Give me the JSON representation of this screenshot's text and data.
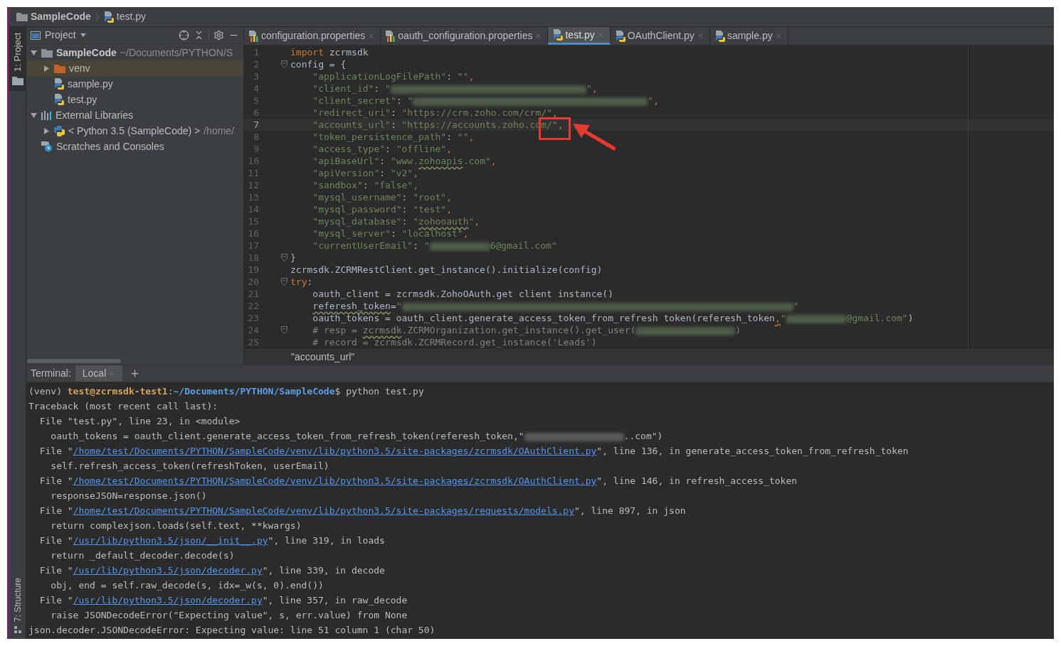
{
  "breadcrumb": [
    {
      "label": "SampleCode",
      "kind": "folder"
    },
    {
      "label": "test.py",
      "kind": "python"
    }
  ],
  "tool_strip": {
    "top": "1: Project",
    "bottom": "7: Structure"
  },
  "project_panel": {
    "title": "Project",
    "tree": [
      {
        "label": "SampleCode",
        "detail": "~/Documents/PYTHON/S",
        "kind": "project",
        "expanded": true,
        "selected": false,
        "children": [
          {
            "label": "venv",
            "kind": "excluded-folder",
            "expanded": false,
            "selected": true
          },
          {
            "label": "sample.py",
            "kind": "python",
            "selected": false
          },
          {
            "label": "test.py",
            "kind": "python",
            "selected": false
          }
        ]
      },
      {
        "label": "External Libraries",
        "kind": "libraries",
        "expanded": true,
        "selected": false,
        "children": [
          {
            "label": "< Python 3.5 (SampleCode) >",
            "detail": "/home/",
            "kind": "sdk",
            "expanded": false,
            "selected": false
          }
        ]
      },
      {
        "label": "Scratches and Consoles",
        "kind": "scratches",
        "selected": false
      }
    ]
  },
  "editor": {
    "tabs": [
      {
        "label": "configuration.properties",
        "kind": "properties",
        "selected": false
      },
      {
        "label": "oauth_configuration.properties",
        "kind": "properties",
        "selected": false
      },
      {
        "label": "test.py",
        "kind": "python",
        "selected": true
      },
      {
        "label": "OAuthClient.py",
        "kind": "python",
        "selected": false
      },
      {
        "label": "sample.py",
        "kind": "python",
        "selected": false
      }
    ],
    "lines": [
      {
        "number": "1",
        "current": false,
        "fold": false,
        "segments": [
          {
            "kind": "kw",
            "text": "import"
          },
          {
            "kind": "id",
            "text": " zcrmsdk"
          }
        ]
      },
      {
        "number": "2",
        "current": false,
        "fold": true,
        "segments": [
          {
            "kind": "id",
            "text": "config = {"
          }
        ]
      },
      {
        "number": "3",
        "current": false,
        "fold": false,
        "segments": [
          {
            "kind": "str",
            "text": "    \"applicationLogFilePath\""
          },
          {
            "kind": "id",
            "text": ": "
          },
          {
            "kind": "str",
            "text": "\"\""
          },
          {
            "kind": "punct",
            "text": ","
          }
        ]
      },
      {
        "number": "4",
        "current": false,
        "fold": false,
        "segments": [
          {
            "kind": "str",
            "text": "    \"client_id\""
          },
          {
            "kind": "id",
            "text": ": "
          },
          {
            "kind": "str",
            "text": "\""
          },
          {
            "kind": "redacted-l"
          },
          {
            "kind": "str",
            "text": "\""
          },
          {
            "kind": "punct",
            "text": ","
          }
        ]
      },
      {
        "number": "5",
        "current": false,
        "fold": false,
        "segments": [
          {
            "kind": "str",
            "text": "    \"client_secret\""
          },
          {
            "kind": "id",
            "text": ": "
          },
          {
            "kind": "str",
            "text": "\""
          },
          {
            "kind": "redacted-xl"
          },
          {
            "kind": "str",
            "text": "\""
          },
          {
            "kind": "punct",
            "text": ","
          }
        ]
      },
      {
        "number": "6",
        "current": false,
        "fold": false,
        "segments": [
          {
            "kind": "str",
            "text": "    \"redirect_uri\""
          },
          {
            "kind": "id",
            "text": ": "
          },
          {
            "kind": "str",
            "text": "\"https://crm.zoho.com/crm/\""
          },
          {
            "kind": "punct",
            "text": ","
          }
        ]
      },
      {
        "number": "7",
        "current": true,
        "fold": false,
        "segments": [
          {
            "kind": "str",
            "text": "    \"accounts_url\""
          },
          {
            "kind": "id",
            "text": ": "
          },
          {
            "kind": "str",
            "text": "\"https://accounts.zoho.com/\""
          },
          {
            "kind": "punct",
            "text": ","
          }
        ]
      },
      {
        "number": "8",
        "current": false,
        "fold": false,
        "segments": [
          {
            "kind": "str",
            "text": "    \"token_persistence_path\""
          },
          {
            "kind": "id",
            "text": ": "
          },
          {
            "kind": "str",
            "text": "\"\""
          },
          {
            "kind": "punct",
            "text": ","
          }
        ]
      },
      {
        "number": "9",
        "current": false,
        "fold": false,
        "segments": [
          {
            "kind": "str",
            "text": "    \"access_type\""
          },
          {
            "kind": "id",
            "text": ": "
          },
          {
            "kind": "str",
            "text": "\"offline\""
          },
          {
            "kind": "punct",
            "text": ","
          }
        ]
      },
      {
        "number": "10",
        "current": false,
        "fold": false,
        "segments": [
          {
            "kind": "str",
            "text": "    \"apiBaseUrl\""
          },
          {
            "kind": "id",
            "text": ": "
          },
          {
            "kind": "str",
            "text": "\"www."
          },
          {
            "kind": "str-typo",
            "text": "zohoapis"
          },
          {
            "kind": "str",
            "text": ".com\""
          },
          {
            "kind": "punct",
            "text": ","
          }
        ]
      },
      {
        "number": "11",
        "current": false,
        "fold": false,
        "segments": [
          {
            "kind": "str",
            "text": "    \"apiVersion\""
          },
          {
            "kind": "id",
            "text": ": "
          },
          {
            "kind": "str",
            "text": "\"v2\""
          },
          {
            "kind": "punct",
            "text": ","
          }
        ]
      },
      {
        "number": "12",
        "current": false,
        "fold": false,
        "segments": [
          {
            "kind": "str",
            "text": "    \"sandbox\""
          },
          {
            "kind": "id",
            "text": ": "
          },
          {
            "kind": "str",
            "text": "\"false\""
          },
          {
            "kind": "punct",
            "text": ","
          }
        ]
      },
      {
        "number": "13",
        "current": false,
        "fold": false,
        "segments": [
          {
            "kind": "str",
            "text": "    \"mysql_username\""
          },
          {
            "kind": "id",
            "text": ": "
          },
          {
            "kind": "str",
            "text": "\"root\""
          },
          {
            "kind": "punct",
            "text": ","
          }
        ]
      },
      {
        "number": "14",
        "current": false,
        "fold": false,
        "segments": [
          {
            "kind": "str",
            "text": "    \"mysql_password\""
          },
          {
            "kind": "id",
            "text": ": "
          },
          {
            "kind": "str",
            "text": "\"test\""
          },
          {
            "kind": "punct",
            "text": ","
          }
        ]
      },
      {
        "number": "15",
        "current": false,
        "fold": false,
        "segments": [
          {
            "kind": "str",
            "text": "    \"mysql_database\""
          },
          {
            "kind": "id",
            "text": ": "
          },
          {
            "kind": "str",
            "text": "\""
          },
          {
            "kind": "str-typo",
            "text": "zohooauth"
          },
          {
            "kind": "str",
            "text": "\""
          },
          {
            "kind": "punct",
            "text": ","
          }
        ]
      },
      {
        "number": "16",
        "current": false,
        "fold": false,
        "segments": [
          {
            "kind": "str",
            "text": "    \"mysql_server\""
          },
          {
            "kind": "id",
            "text": ": "
          },
          {
            "kind": "str",
            "text": "\"localhost\""
          },
          {
            "kind": "punct",
            "text": ","
          }
        ]
      },
      {
        "number": "17",
        "current": false,
        "fold": false,
        "segments": [
          {
            "kind": "str",
            "text": "    \"currentUserEmail\""
          },
          {
            "kind": "id",
            "text": ": "
          },
          {
            "kind": "str",
            "text": "\""
          },
          {
            "kind": "redacted-s"
          },
          {
            "kind": "str",
            "text": "6@gmail.com\""
          }
        ]
      },
      {
        "number": "18",
        "current": false,
        "fold": true,
        "segments": [
          {
            "kind": "id",
            "text": "}"
          }
        ]
      },
      {
        "number": "19",
        "current": false,
        "fold": false,
        "segments": [
          {
            "kind": "id",
            "text": "zcrmsdk.ZCRMRestClient.get_instance().initialize(config)"
          }
        ]
      },
      {
        "number": "20",
        "current": false,
        "fold": true,
        "segments": [
          {
            "kind": "kw",
            "text": "try"
          },
          {
            "kind": "id",
            "text": ":"
          }
        ]
      },
      {
        "number": "21",
        "current": false,
        "fold": false,
        "segments": [
          {
            "kind": "id",
            "text": "    oauth_client = zcrmsdk.ZohoOAuth.get client instance()"
          }
        ]
      },
      {
        "number": "22",
        "current": false,
        "fold": false,
        "segments": [
          {
            "kind": "typo",
            "text": "    referesh_token"
          },
          {
            "kind": "id",
            "text": "="
          },
          {
            "kind": "str",
            "text": "\""
          },
          {
            "kind": "redacted-xxl"
          },
          {
            "kind": "str",
            "text": "\""
          }
        ]
      },
      {
        "number": "23",
        "current": false,
        "fold": false,
        "segments": [
          {
            "kind": "id",
            "text": "    oauth_tokens = oauth_client.generate_access_token_from_refresh token(referesh_token"
          },
          {
            "kind": "punct-typo",
            "text": ","
          },
          {
            "kind": "str",
            "text": "\""
          },
          {
            "kind": "redacted-s"
          },
          {
            "kind": "str",
            "text": "@gmail.com\""
          },
          {
            "kind": "id",
            "text": ")"
          }
        ]
      },
      {
        "number": "24",
        "current": false,
        "fold": true,
        "segments": [
          {
            "kind": "comment",
            "text": "    # resp = "
          },
          {
            "kind": "comment-typo",
            "text": "zcrmsdk"
          },
          {
            "kind": "comment",
            "text": ".ZCRMOrganization.get_instance().get_user("
          },
          {
            "kind": "redacted-m"
          },
          {
            "kind": "comment",
            "text": ")"
          }
        ]
      },
      {
        "number": "25",
        "current": false,
        "fold": false,
        "segments": [
          {
            "kind": "comment",
            "text": "    # record = zcrmsdk.ZCRMRecord.get_instance('Leads')"
          }
        ]
      }
    ],
    "hint": "\"accounts_url\""
  },
  "terminal": {
    "label": "Terminal:",
    "tabs": [
      {
        "label": "Local",
        "selected": true
      }
    ],
    "lines": [
      [
        {
          "kind": "plain",
          "text": "(venv) "
        },
        {
          "kind": "user",
          "text": "test@zcrmsdk-test1"
        },
        {
          "kind": "plain",
          "text": ":"
        },
        {
          "kind": "path",
          "text": "~/Documents/PYTHON/SampleCode"
        },
        {
          "kind": "plain",
          "text": "$ python test.py"
        }
      ],
      [
        {
          "kind": "plain",
          "text": "Traceback (most recent call last):"
        }
      ],
      [
        {
          "kind": "plain",
          "text": "  File \"test.py\", line 23, in <module>"
        }
      ],
      [
        {
          "kind": "plain",
          "text": "    oauth_tokens = oauth_client.generate_access_token_from_refresh_token(referesh_token,\""
        },
        {
          "kind": "redacted-m"
        },
        {
          "kind": "plain",
          "text": "..com\")"
        }
      ],
      [
        {
          "kind": "plain",
          "text": "  File \""
        },
        {
          "kind": "link",
          "text": "/home/test/Documents/PYTHON/SampleCode/venv/lib/python3.5/site-packages/zcrmsdk/OAuthClient.py"
        },
        {
          "kind": "plain",
          "text": "\", line 136, in generate_access_token_from_refresh_token"
        }
      ],
      [
        {
          "kind": "plain",
          "text": "    self.refresh_access_token(refreshToken, userEmail)"
        }
      ],
      [
        {
          "kind": "plain",
          "text": "  File \""
        },
        {
          "kind": "link",
          "text": "/home/test/Documents/PYTHON/SampleCode/venv/lib/python3.5/site-packages/zcrmsdk/OAuthClient.py"
        },
        {
          "kind": "plain",
          "text": "\", line 146, in refresh_access_token"
        }
      ],
      [
        {
          "kind": "plain",
          "text": "    responseJSON=response.json()"
        }
      ],
      [
        {
          "kind": "plain",
          "text": "  File \""
        },
        {
          "kind": "link",
          "text": "/home/test/Documents/PYTHON/SampleCode/venv/lib/python3.5/site-packages/requests/models.py"
        },
        {
          "kind": "plain",
          "text": "\", line 897, in json"
        }
      ],
      [
        {
          "kind": "plain",
          "text": "    return complexjson.loads(self.text, **kwargs)"
        }
      ],
      [
        {
          "kind": "plain",
          "text": "  File \""
        },
        {
          "kind": "link",
          "text": "/usr/lib/python3.5/json/__init__.py"
        },
        {
          "kind": "plain",
          "text": "\", line 319, in loads"
        }
      ],
      [
        {
          "kind": "plain",
          "text": "    return _default_decoder.decode(s)"
        }
      ],
      [
        {
          "kind": "plain",
          "text": "  File \""
        },
        {
          "kind": "link",
          "text": "/usr/lib/python3.5/json/decoder.py"
        },
        {
          "kind": "plain",
          "text": "\", line 339, in decode"
        }
      ],
      [
        {
          "kind": "plain",
          "text": "    obj, end = self.raw_decode(s, idx=_w(s, 0).end())"
        }
      ],
      [
        {
          "kind": "plain",
          "text": "  File \""
        },
        {
          "kind": "link",
          "text": "/usr/lib/python3.5/json/decoder.py"
        },
        {
          "kind": "plain",
          "text": "\", line 357, in raw_decode"
        }
      ],
      [
        {
          "kind": "plain",
          "text": "    raise JSONDecodeError(\"Expecting value\", s, err.value) from None"
        }
      ],
      [
        {
          "kind": "plain",
          "text": "json.decoder.JSONDecodeError: Expecting value: line 51 column 1 (char 50)"
        }
      ]
    ]
  }
}
